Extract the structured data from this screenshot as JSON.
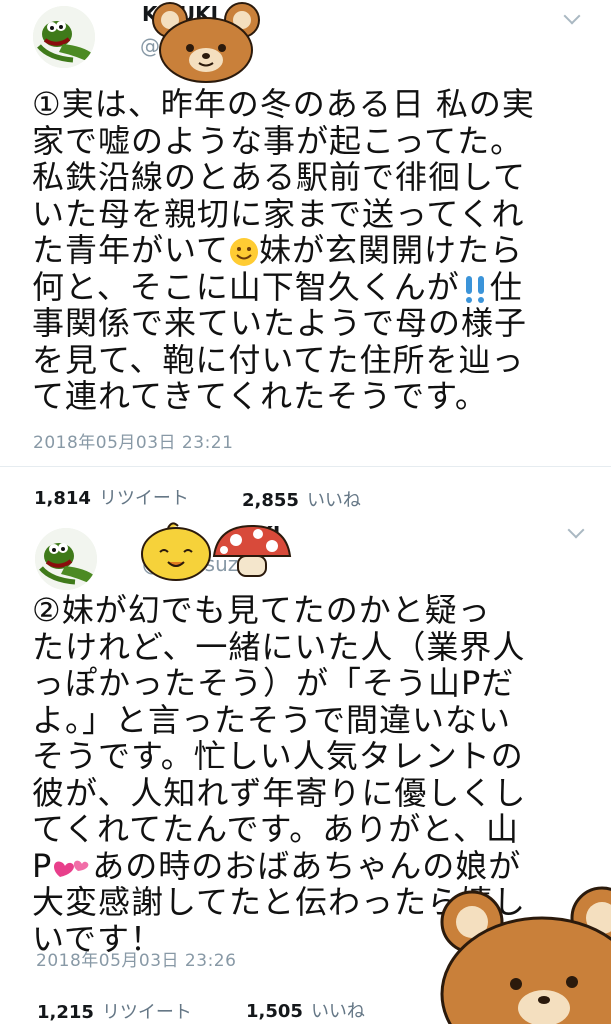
{
  "tweets": [
    {
      "user_name": "K SUKI",
      "handle": "@ uki",
      "text_lines": [
        "①実は、昨年の冬のある日 私の実",
        "家で嘘のような事が起こってた。",
        "私鉄沿線のとある駅前で徘徊して",
        "いた母を親切に家まで送ってくれ",
        "た青年がいて",
        "妹が玄関開けたら",
        "何と、そこに山下智久くんが",
        "仕",
        "事関係で来ていたようで母の様子",
        "を見て、鞄に付いてた住所を辿っ",
        "て連れてきてくれたそうです。"
      ],
      "timestamp": "2018年05月03日 23:21",
      "retweets": "1,814",
      "retweet_label": "リツイート",
      "likes": "2,855",
      "likes_label": "いいね"
    },
    {
      "user_name": "S KI",
      "handle": "@ ayosuz ki",
      "text_lines": [
        "②妹が幻でも見てたのかと疑っ",
        "たけれど、一緒にいた人（業界人",
        "っぽかったそう）が「そう山Pだ",
        "よ。」と言ったそうで間違いない",
        "そうです。忙しい人気タレントの",
        "彼が、人知れず年寄りに優しくし",
        "てくれてたんです。ありがと、山",
        "P",
        "あの時のおばあちゃんの娘が",
        "大変感謝してたと伝わったら嬉し",
        "いです！"
      ],
      "timestamp": "2018年05月03日 23:26",
      "retweets": "1,215",
      "retweet_label": "リツイート",
      "likes": "1,505",
      "likes_label": "いいね"
    }
  ],
  "icons": {
    "avatar": "frog-avatar-icon",
    "sticker_bear": "rilakkuma-bear-icon",
    "sticker_chick": "yellow-chick-icon",
    "sticker_mushroom": "red-mushroom-icon",
    "emoji_smile": "smiling-face-emoji",
    "emoji_exclaim": "double-exclamation-emoji",
    "emoji_hearts": "two-hearts-emoji",
    "menu": "chevron-down-icon"
  },
  "colors": {
    "text": "#111111",
    "meta": "#8899a6",
    "bear": "#c9803a",
    "exclaim": "#3b94d9",
    "hearts": "#e83f8b"
  }
}
